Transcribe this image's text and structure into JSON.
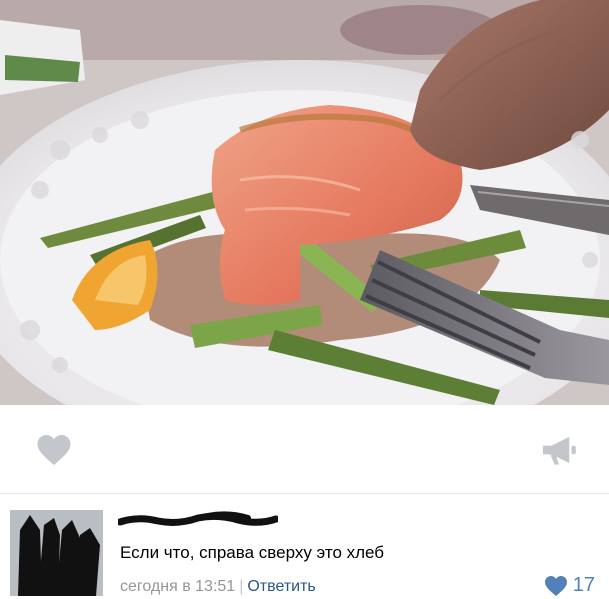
{
  "post": {
    "photo": {
      "description_icon": "photo-image"
    },
    "actions": {
      "like_icon": "heart-icon",
      "share_icon": "megaphone-icon"
    }
  },
  "comment": {
    "author_redacted": true,
    "text": "Если что, справа сверху это хлеб",
    "date": "сегодня в 13:51",
    "separator": "|",
    "reply_label": "Ответить",
    "likes_count": "17",
    "likes_icon": "heart-icon"
  },
  "colors": {
    "accent": "#5181b8",
    "link": "#2a5885",
    "muted": "#939699",
    "icon_gray": "#c3c6ca"
  }
}
